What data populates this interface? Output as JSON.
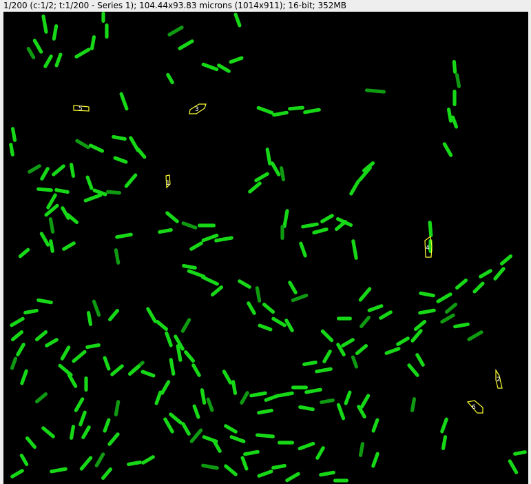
{
  "window": {
    "info_text": "1/200 (c:1/2; t:1/200 - Series 1); 104.44x93.83 microns (1014x911); 16-bit; 352MB"
  },
  "image": {
    "background_color": "#000000",
    "cell_color": "#17d817",
    "roi_color": "#ffff33"
  },
  "rois": [
    {
      "label": "1"
    },
    {
      "label": "2"
    },
    {
      "label": "3"
    },
    {
      "label": "4"
    },
    {
      "label": "5"
    },
    {
      "label": "6"
    }
  ]
}
